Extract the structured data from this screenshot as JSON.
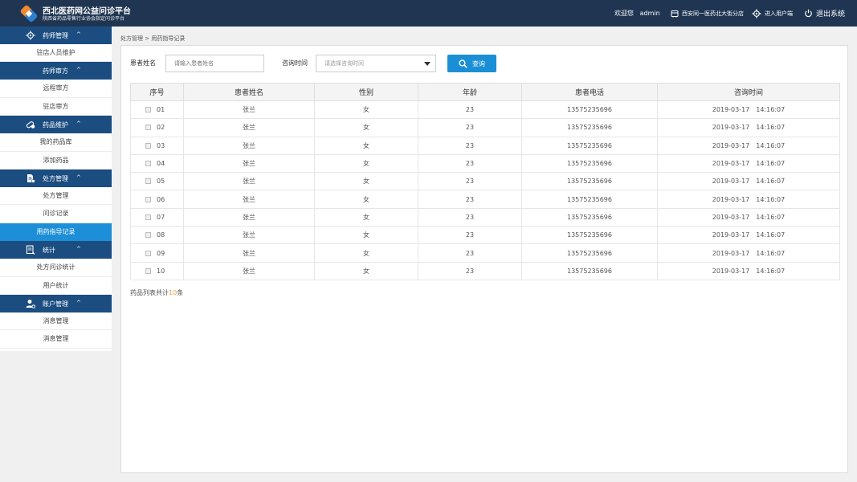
{
  "header": {
    "title": "西北医药网公益问诊平台",
    "subtitle": "陕西省药品零售行业协会指定问诊平台",
    "welcome_prefix": "欢迎您",
    "username": "admin",
    "store_name": "西安同一医药北大街分店",
    "user_center": "进入用户端",
    "logout": "退出系统",
    "brand_colors": {
      "bar": "#1f3552",
      "logo_orange": "#f0892c",
      "logo_blue": "#2d7fd0"
    }
  },
  "sidebar": {
    "groups": [
      {
        "label": "药师管理",
        "icon": "gear-icon",
        "items": [
          {
            "label": "驻店人员维护"
          }
        ]
      },
      {
        "label": "药师审方",
        "icon": "",
        "items": [
          {
            "label": "远程审方"
          },
          {
            "label": "驻店审方"
          }
        ]
      },
      {
        "label": "药品维护",
        "icon": "pill-icon",
        "items": [
          {
            "label": "我的药品库"
          },
          {
            "label": "添加药品"
          }
        ]
      },
      {
        "label": "处方管理",
        "icon": "prescription-icon",
        "items": [
          {
            "label": "处方管理"
          },
          {
            "label": "问诊记录"
          },
          {
            "label": "用药指导记录",
            "active": true
          }
        ]
      },
      {
        "label": "统计",
        "icon": "report-icon",
        "items": [
          {
            "label": "处方问诊统计"
          },
          {
            "label": "用户统计"
          }
        ]
      },
      {
        "label": "账户管理",
        "icon": "user-settings-icon",
        "items": [
          {
            "label": "消息管理"
          },
          {
            "label": "消息管理"
          }
        ]
      }
    ],
    "chevron": "^",
    "colors": {
      "group_bg": "#1b4d80",
      "active_bg": "#1d8ed8"
    }
  },
  "breadcrumb": "处方管理 > 用药指导记录",
  "filters": {
    "name_label": "患者姓名",
    "name_placeholder": "请输入患者姓名",
    "time_label": "咨询时间",
    "time_placeholder": "请选择咨询时间",
    "query_button": "查询"
  },
  "table": {
    "columns": [
      "序号",
      "患者姓名",
      "性别",
      "年龄",
      "患者电话",
      "咨询时间"
    ],
    "rows": [
      {
        "idx": "01",
        "name": "张兰",
        "gender": "女",
        "age": "23",
        "phone": "13575235696",
        "date": "2019-03-17",
        "time": "14:16:07"
      },
      {
        "idx": "02",
        "name": "张兰",
        "gender": "女",
        "age": "23",
        "phone": "13575235696",
        "date": "2019-03-17",
        "time": "14:16:07"
      },
      {
        "idx": "03",
        "name": "张兰",
        "gender": "女",
        "age": "23",
        "phone": "13575235696",
        "date": "2019-03-17",
        "time": "14:16:07"
      },
      {
        "idx": "04",
        "name": "张兰",
        "gender": "女",
        "age": "23",
        "phone": "13575235696",
        "date": "2019-03-17",
        "time": "14:16:07"
      },
      {
        "idx": "05",
        "name": "张兰",
        "gender": "女",
        "age": "23",
        "phone": "13575235696",
        "date": "2019-03-17",
        "time": "14:16:07"
      },
      {
        "idx": "06",
        "name": "张兰",
        "gender": "女",
        "age": "23",
        "phone": "13575235696",
        "date": "2019-03-17",
        "time": "14:16:07"
      },
      {
        "idx": "07",
        "name": "张兰",
        "gender": "女",
        "age": "23",
        "phone": "13575235696",
        "date": "2019-03-17",
        "time": "14:16:07"
      },
      {
        "idx": "08",
        "name": "张兰",
        "gender": "女",
        "age": "23",
        "phone": "13575235696",
        "date": "2019-03-17",
        "time": "14:16:07"
      },
      {
        "idx": "09",
        "name": "张兰",
        "gender": "女",
        "age": "23",
        "phone": "13575235696",
        "date": "2019-03-17",
        "time": "14:16:07"
      },
      {
        "idx": "10",
        "name": "张兰",
        "gender": "女",
        "age": "23",
        "phone": "13575235696",
        "date": "2019-03-17",
        "time": "14:16:07"
      }
    ]
  },
  "summary": {
    "prefix": "药品列表共计",
    "count": "10",
    "suffix": "条",
    "count_color": "#e8a33d"
  }
}
